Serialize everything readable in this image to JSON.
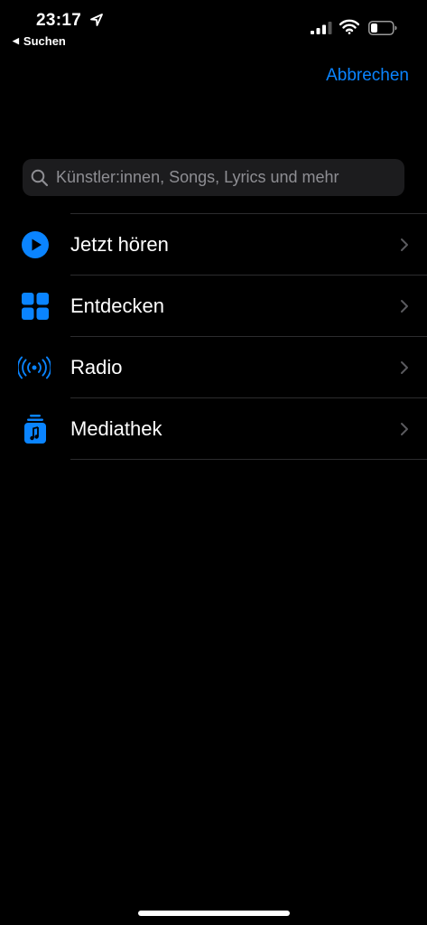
{
  "status_bar": {
    "time": "23:17",
    "back_app": "Suchen",
    "back_icon": "back-triangle",
    "icons": [
      "location-arrow-icon",
      "cellular-signal-icon",
      "wifi-icon",
      "battery-icon"
    ]
  },
  "header": {
    "cancel_label": "Abbrechen"
  },
  "search": {
    "placeholder": "Künstler:innen, Songs, Lyrics und mehr",
    "icon": "magnifier-icon"
  },
  "menu": {
    "items": [
      {
        "label": "Jetzt hören",
        "icon": "play-circle-icon"
      },
      {
        "label": "Entdecken",
        "icon": "grid-icon"
      },
      {
        "label": "Radio",
        "icon": "broadcast-icon"
      },
      {
        "label": "Mediathek",
        "icon": "library-icon"
      }
    ]
  },
  "colors": {
    "accent": "#0a84ff",
    "background": "#000000",
    "search_bg": "#1c1c1e",
    "separator": "#2c2c2e",
    "placeholder": "#8e8e93"
  }
}
